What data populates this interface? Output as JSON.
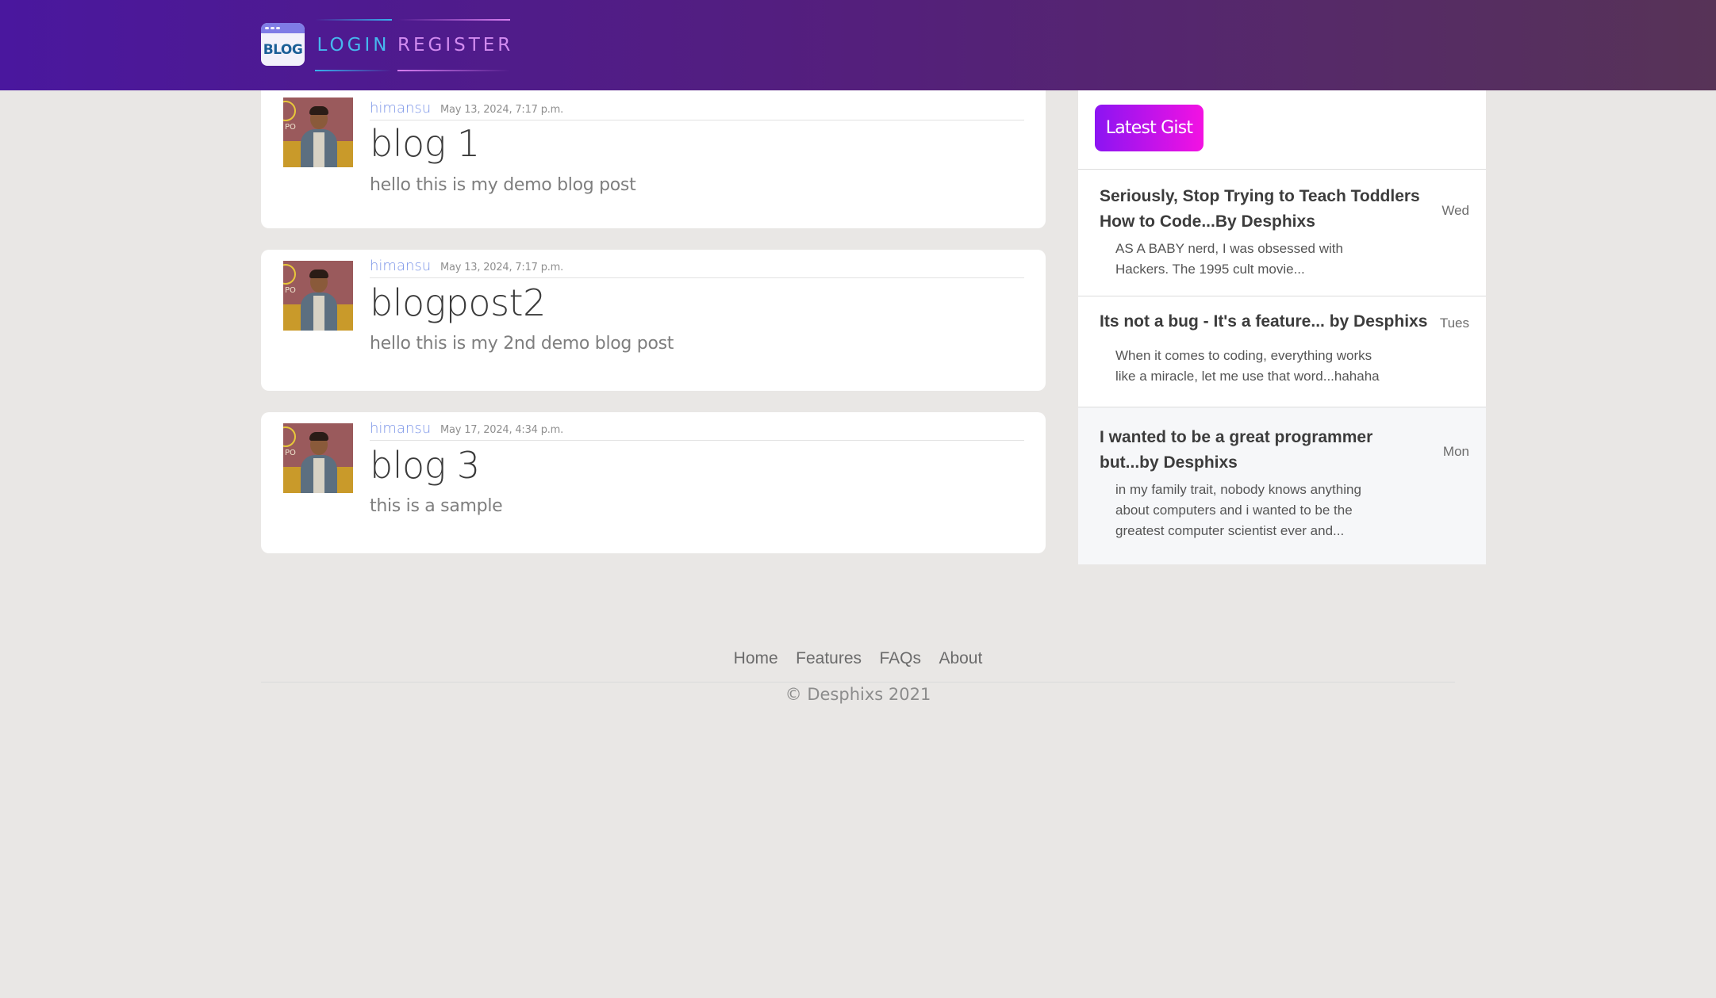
{
  "header": {
    "logo_text": "BLOG",
    "nav": {
      "login": "LOGIN",
      "register": "REGISTER"
    }
  },
  "posts": [
    {
      "author": "himansu",
      "date": "May 13, 2024, 7:17 p.m.",
      "title": "blog 1",
      "excerpt": "hello this is my demo blog post"
    },
    {
      "author": "himansu",
      "date": "May 13, 2024, 7:17 p.m.",
      "title": "blogpost2",
      "excerpt": "hello this is my 2nd demo blog post"
    },
    {
      "author": "himansu",
      "date": "May 17, 2024, 4:34 p.m.",
      "title": "blog 3",
      "excerpt": "this is a sample"
    }
  ],
  "sidebar": {
    "button_label": "Latest Gist",
    "items": [
      {
        "title": "Seriously, Stop Trying to Teach Toddlers How to Code...By Desphixs",
        "day": "Wed",
        "text": "AS A BABY nerd, I was obsessed with Hackers. The 1995 cult movie..."
      },
      {
        "title": "Its not a bug - It's a feature... by Desphixs",
        "day": "Tues",
        "text": "When it comes to coding, everything works like a miracle, let me use that word...hahaha"
      },
      {
        "title": "I wanted to be a great programmer but...by Desphixs",
        "day": "Mon",
        "text": "in my family trait, nobody knows anything about computers and i wanted to be the greatest computer scientist ever and..."
      }
    ]
  },
  "footer": {
    "links": [
      "Home",
      "Features",
      "FAQs",
      "About"
    ],
    "copyright": "© Desphixs 2021"
  },
  "colors": {
    "header_gradient_start": "#4a179e",
    "header_gradient_end": "#573357",
    "login_accent": "#46b8ee",
    "register_accent": "#d28bf0",
    "gist_button_start": "#8b14f2",
    "gist_button_end": "#f312e2",
    "author_link": "#7d96e8"
  }
}
